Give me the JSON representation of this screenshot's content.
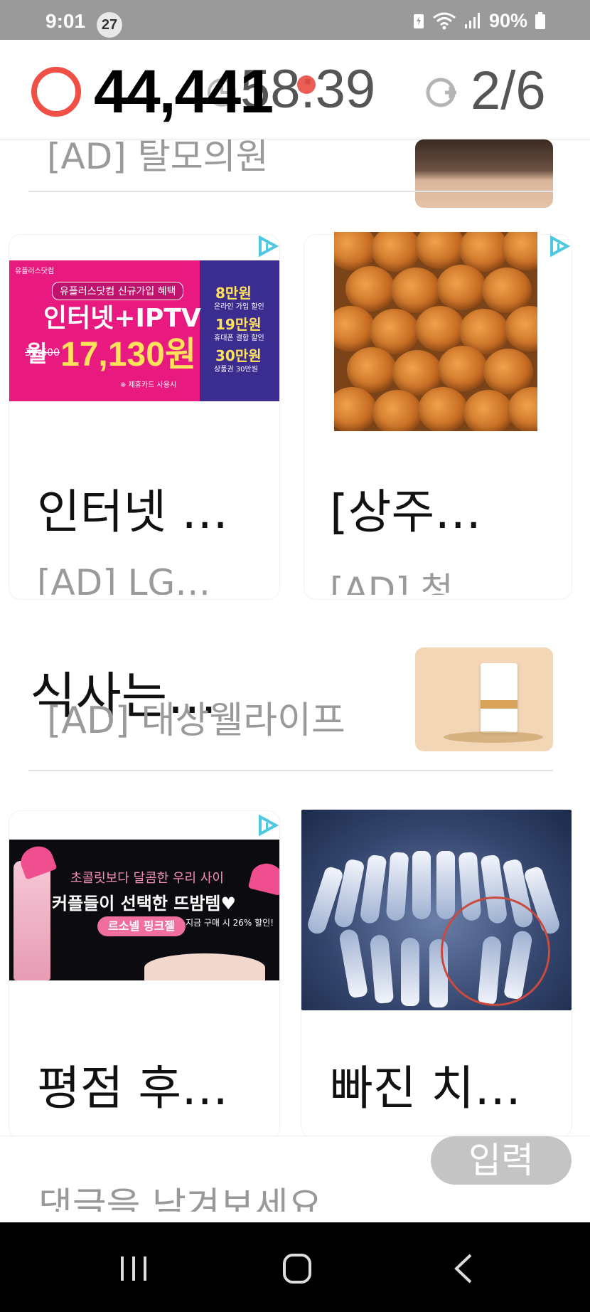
{
  "status_bar": {
    "time": "9:01",
    "notification_count": "27",
    "battery": "90%"
  },
  "header": {
    "reward_count": "44,441",
    "timer": "58:39",
    "page_progress": "2/6"
  },
  "ads_top": {
    "sub_text": "[AD] 탈모의원"
  },
  "cards_row1": [
    {
      "title": "인터넷 …",
      "sub": "[AD] LG…",
      "image": {
        "brand": "유플러스닷컴",
        "badge": "유플러스닷컴 신규가입 혜택",
        "headline": "인터넷+IPTV",
        "price_prefix": "월",
        "price": "17,130원",
        "old_price": "39,600",
        "note": "※ 제휴카드 사용시",
        "benefits": [
          {
            "amount": "8만원",
            "desc": "온라인 가입 할인"
          },
          {
            "amount": "19만원",
            "desc": "휴대폰 결합 할인"
          },
          {
            "amount": "30만원",
            "desc": "상품권 30만원"
          }
        ]
      }
    },
    {
      "title": "[상주…",
      "sub": "[AD] 청…"
    }
  ],
  "mid_ad": {
    "title": "식사는…",
    "sub": "[AD] 대상웰라이프"
  },
  "cards_row2": [
    {
      "title": "평점 후…",
      "image": {
        "line1": "초콜릿보다 달콤한 우리 사이",
        "line2": "커플들이 선택한 뜨밤템♥",
        "product": "르소넬 핑크젤",
        "discount": "지금 구매 시 26% 할인!"
      }
    },
    {
      "title": "빠진 치…"
    }
  ],
  "comment": {
    "placeholder": "댓글을 남겨보세요",
    "submit_label": "입력"
  },
  "colors": {
    "accent_red": "#ef4f45",
    "ad_blue": "#4ec8e0",
    "submit_gray": "#c4c4c4"
  }
}
